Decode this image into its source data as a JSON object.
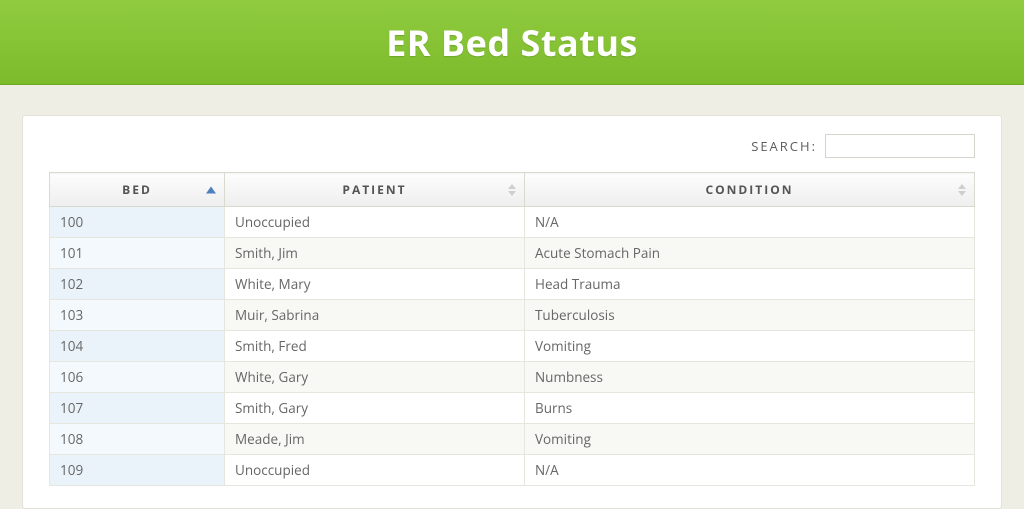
{
  "header": {
    "title": "ER Bed Status"
  },
  "search": {
    "label": "SEARCH:",
    "value": ""
  },
  "table": {
    "columns": {
      "bed": "BED",
      "patient": "PATIENT",
      "condition": "CONDITION"
    },
    "rows": [
      {
        "bed": "100",
        "patient": "Unoccupied",
        "condition": "N/A"
      },
      {
        "bed": "101",
        "patient": "Smith, Jim",
        "condition": "Acute Stomach Pain"
      },
      {
        "bed": "102",
        "patient": "White, Mary",
        "condition": "Head Trauma"
      },
      {
        "bed": "103",
        "patient": "Muir, Sabrina",
        "condition": "Tuberculosis"
      },
      {
        "bed": "104",
        "patient": "Smith, Fred",
        "condition": "Vomiting"
      },
      {
        "bed": "106",
        "patient": "White, Gary",
        "condition": "Numbness"
      },
      {
        "bed": "107",
        "patient": "Smith, Gary",
        "condition": "Burns"
      },
      {
        "bed": "108",
        "patient": "Meade, Jim",
        "condition": "Vomiting"
      },
      {
        "bed": "109",
        "patient": "Unoccupied",
        "condition": "N/A"
      }
    ]
  }
}
